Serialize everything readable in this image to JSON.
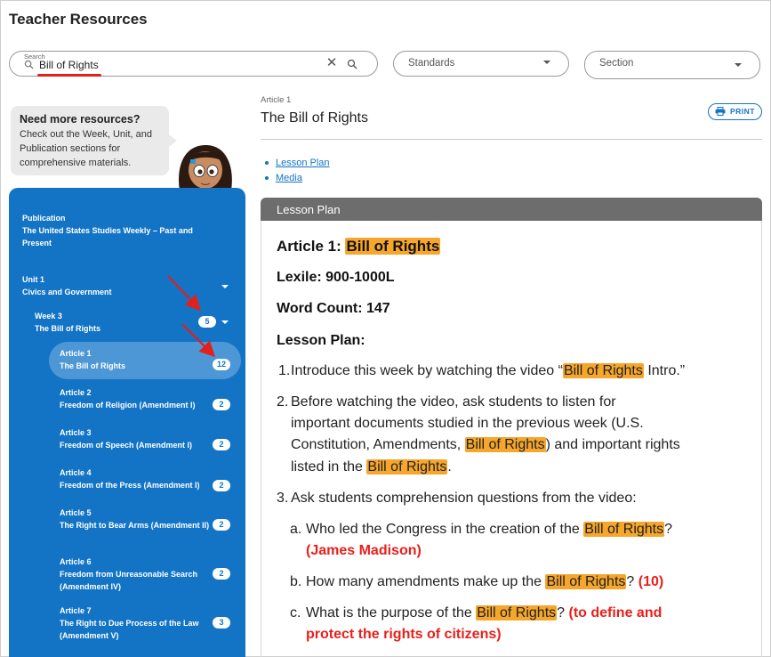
{
  "page": {
    "title": "Teacher Resources"
  },
  "filters": {
    "search_label": "Search",
    "search_value": "Bill of Rights",
    "standards_label": "Standards",
    "section_label": "Section"
  },
  "promo": {
    "title": "Need more resources?",
    "text": "Check out the Week, Unit, and Publication sections for comprehensive materials."
  },
  "sidebar": {
    "publication_label": "Publication",
    "publication_title": "The United States Studies Weekly – Past and Present",
    "unit_label": "Unit 1",
    "unit_title": "Civics and Government",
    "week_label": "Week 3",
    "week_title": "The Bill of Rights",
    "week_count": "5",
    "articles": [
      {
        "label": "Article 1",
        "title": "The Bill of Rights",
        "count": "12"
      },
      {
        "label": "Article 2",
        "title": "Freedom of Religion (Amendment I)",
        "count": "2"
      },
      {
        "label": "Article 3",
        "title": "Freedom of Speech (Amendment I)",
        "count": "2"
      },
      {
        "label": "Article 4",
        "title": "Freedom of the Press (Amendment I)",
        "count": "2"
      },
      {
        "label": "Article 5",
        "title": "The Right to Bear Arms (Amendment II)",
        "count": "2"
      },
      {
        "label": "Article 6",
        "title": "Freedom from Unreasonable Search (Amendment IV)",
        "count": "2"
      },
      {
        "label": "Article 7",
        "title": "The Right to Due Process of the Law (Amendment V)",
        "count": "3"
      }
    ]
  },
  "article": {
    "kicker": "Article 1",
    "title": "The Bill of Rights",
    "print_label": "PRINT",
    "links": [
      "Lesson Plan",
      "Media"
    ]
  },
  "panel": {
    "header": "Lesson Plan",
    "heading_article_prefix": "Article 1: ",
    "heading_article_highlight": "Bill of Rights",
    "lexile": "Lexile: 900-1000L",
    "word_count": "Word Count: 147",
    "lesson_plan": "Lesson Plan:",
    "item1_num": "1.",
    "item1_a": "Introduce this week by watching the video “",
    "item1_hl": "Bill of Rights",
    "item1_b": " Intro.”",
    "item2_num": "2.",
    "item2_l1": "Before watching the video, ask students to listen for",
    "item2_l2": "important documents studied in the previous week (U.S.",
    "item2_l3a": "Constitution, Amendments, ",
    "item2_l3hl": "Bill of Rights",
    "item2_l3b": ") and important rights",
    "item2_l4a": "listed in the ",
    "item2_l4hl": "Bill of Rights",
    "item2_l4b": ".",
    "item3_num": "3.",
    "item3": "Ask students comprehension questions from the video:",
    "qa_num": "a.",
    "qa_a": "Who led the Congress in the creation of the ",
    "qa_hl": "Bill of Rights",
    "qa_b": "?",
    "qa_answer": "(James Madison)",
    "qb_num": "b.",
    "qb_a": "How many amendments make up the ",
    "qb_hl": "Bill of Rights",
    "qb_b": "? ",
    "qb_answer": "(10)",
    "qc_num": "c.",
    "qc_a": "What is the purpose of the ",
    "qc_hl": "Bill of Rights",
    "qc_b": "? ",
    "qc_answer1": "(to define and",
    "qc_answer2": "protect the rights of citizens)"
  },
  "colors": {
    "accent_blue": "#1374c5",
    "highlight": "#f6a62b",
    "answer_red": "#e8201a",
    "panel_header": "#6d6d6d"
  }
}
